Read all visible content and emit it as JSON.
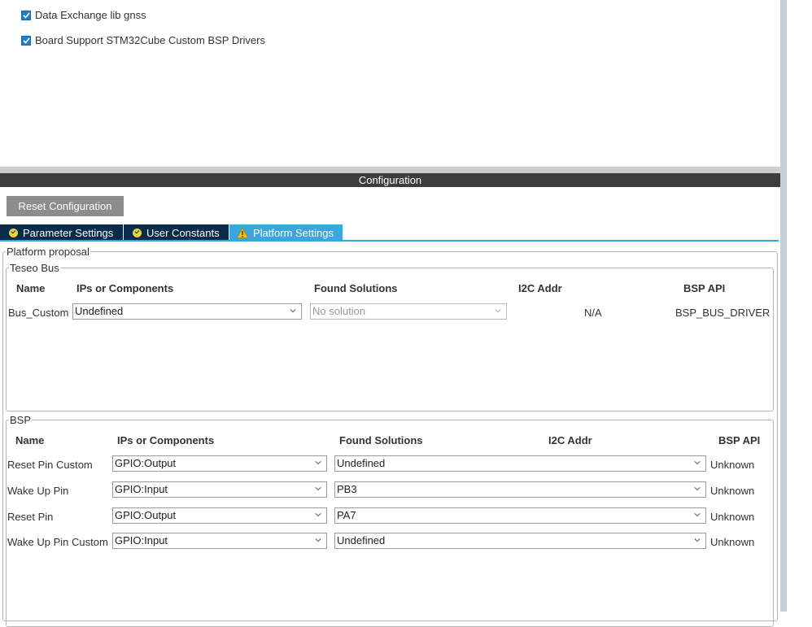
{
  "components": [
    {
      "label": "Data Exchange lib gnss",
      "checked": true
    },
    {
      "label": "Board Support STM32Cube Custom BSP Drivers",
      "checked": true
    }
  ],
  "config": {
    "header": "Configuration",
    "reset_label": "Reset Configuration",
    "tabs": [
      {
        "label": "Parameter Settings",
        "icon": "ok-icon"
      },
      {
        "label": "User Constants",
        "icon": "ok-icon"
      },
      {
        "label": "Platform Settings",
        "icon": "warning-icon",
        "active": true
      }
    ]
  },
  "platform": {
    "legend": "Platform proposal",
    "teseo": {
      "legend": "Teseo Bus",
      "headers": {
        "name": "Name",
        "ips": "IPs or Components",
        "found": "Found Solutions",
        "i2c": "I2C Addr",
        "api": "BSP API"
      },
      "row": {
        "name": "Bus_Custom",
        "ips": "Undefined",
        "found": "No solution",
        "i2c": "N/A",
        "api": "BSP_BUS_DRIVER"
      }
    },
    "bsp": {
      "legend": "BSP",
      "headers": {
        "name": "Name",
        "ips": "IPs or Components",
        "found": "Found Solutions",
        "i2c": "I2C Addr",
        "api": "BSP API"
      },
      "rows": [
        {
          "name": "Reset Pin Custom",
          "ips": "GPIO:Output",
          "found": "Undefined",
          "api": "Unknown"
        },
        {
          "name": "Wake Up Pin",
          "ips": "GPIO:Input",
          "found": "PB3",
          "api": "Unknown"
        },
        {
          "name": "Reset Pin",
          "ips": "GPIO:Output",
          "found": "PA7",
          "api": "Unknown"
        },
        {
          "name": "Wake Up Pin Custom",
          "ips": "GPIO:Input",
          "found": "Undefined",
          "api": "Unknown"
        }
      ]
    }
  },
  "colors": {
    "accent": "#3aa6dd",
    "tab_dark": "#0a2a4a",
    "header_bg": "#3c3c3c",
    "button_gray": "#8c8c8c"
  }
}
